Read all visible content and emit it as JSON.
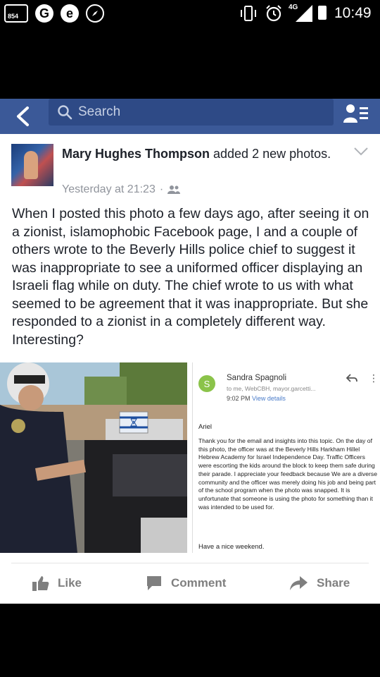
{
  "status_bar": {
    "badge": "854",
    "g_icon": "G",
    "e_icon": "e",
    "network": "4G",
    "time": "10:49"
  },
  "search": {
    "placeholder": "Search"
  },
  "post": {
    "author": "Mary Hughes Thompson",
    "action": " added 2 new photos.",
    "timestamp": "Yesterday at 21:23",
    "dot": "·",
    "privacy_icon": "friends-icon",
    "text": "When I posted this photo a few days ago, after seeing it on a zionist, islamophobic Facebook page, I and a couple of others wrote to the Beverly Hills police chief to suggest it was inappropriate to see a uniformed officer displaying an Israeli flag while on duty.  The chief wrote to us with what seemed to be agreement that it was inappropriate.  But she responded to a zionist in a completely different way.  Interesting?"
  },
  "email": {
    "avatar_letter": "S",
    "sender": "Sandra Spagnoli",
    "to": "to me, WebCBH, mayor.garcetti...",
    "time": "9:02 PM",
    "details_link": "View details",
    "greeting": "Ariel",
    "body": "Thank you for the email and insights into this topic. On the day of this photo, the officer was at the Beverly Hills Harkham Hillel Hebrew Academy  for Israel Independence Day. Traffic Officers were escorting the kids around the block to keep them safe during their parade. I appreciate your feedback because We are a diverse community and the officer was merely doing his job and being part of the school program when the photo was snapped. It is unfortunate that someone is using the photo for something than it was intended to be used for.",
    "closing": "Have a nice weekend."
  },
  "actions": {
    "like": "Like",
    "comment": "Comment",
    "share": "Share"
  },
  "colors": {
    "facebook_blue": "#3b5998",
    "search_bg": "#2e4a86",
    "action_gray": "#7f7f7f"
  }
}
